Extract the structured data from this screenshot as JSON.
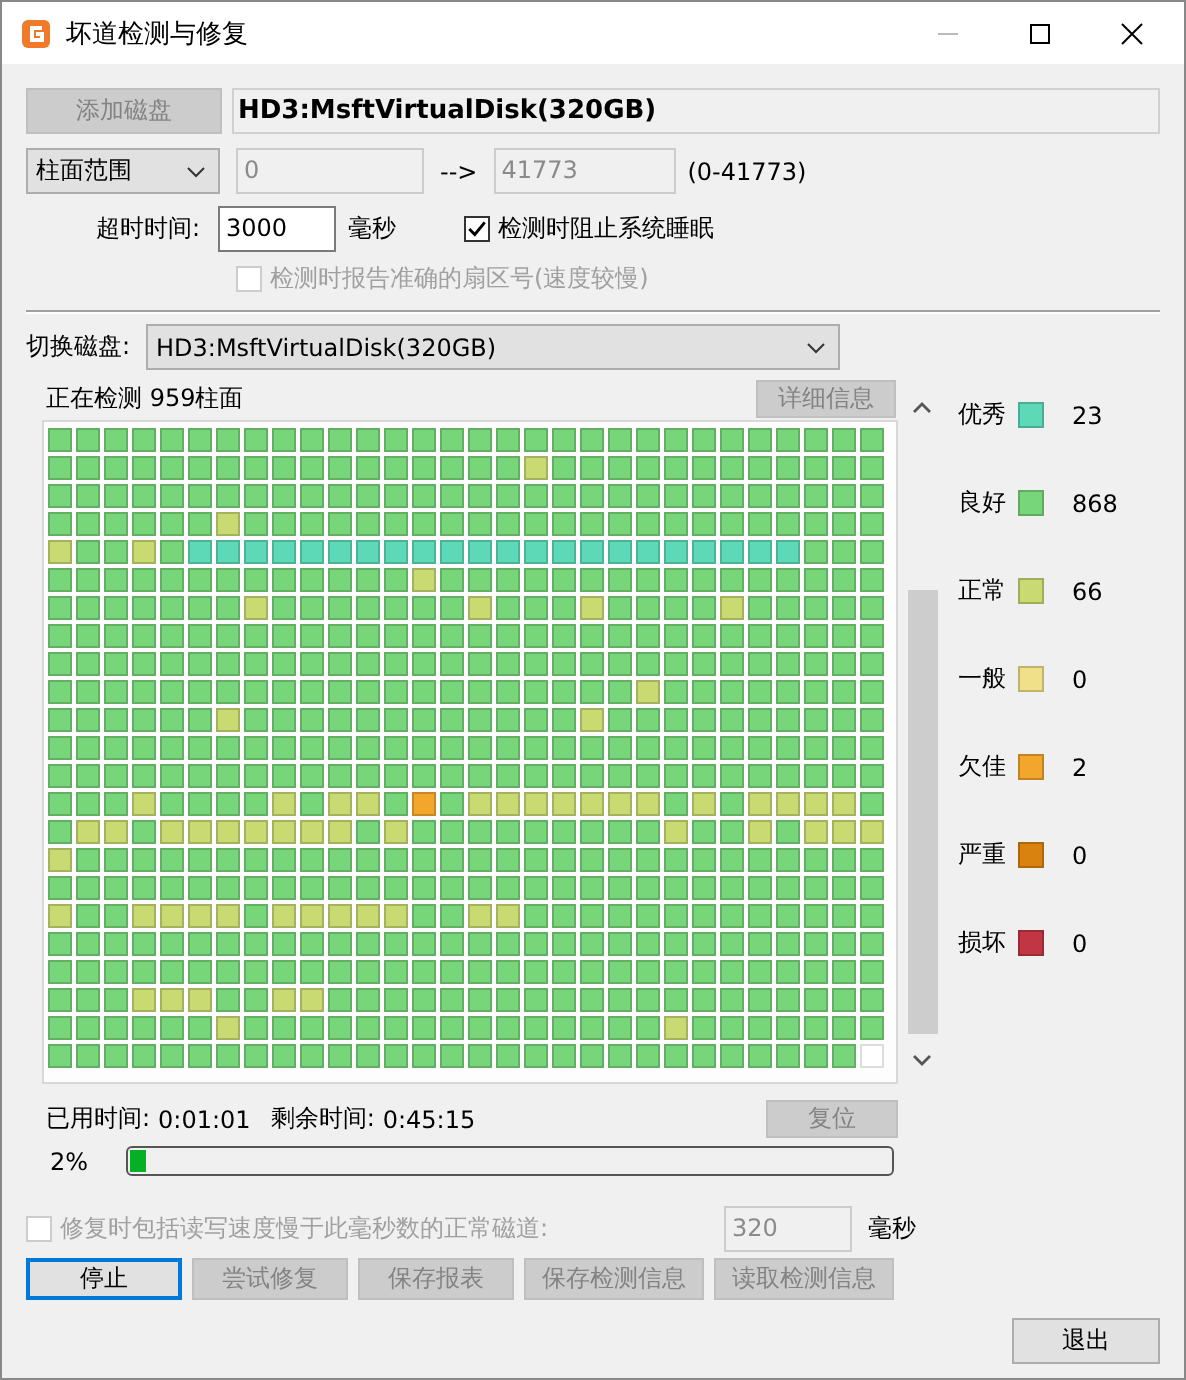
{
  "window": {
    "title": "坏道检测与修复"
  },
  "top": {
    "add_button": {
      "label": "添加磁盘",
      "disabled": true
    },
    "disk_name": "HD3:MsftVirtualDisk(320GB)",
    "range_select": "柱面范围",
    "range_from": "0",
    "arrow": "-->",
    "range_to": "41773",
    "range_hint": "(0-41773)",
    "timeout_label": "超时时间:",
    "timeout_value": "3000",
    "timeout_unit": "毫秒",
    "checkboxes": [
      {
        "label": "检测时阻止系统睡眠",
        "checked": true,
        "disabled": false
      },
      {
        "label": "检测时报告准确的扇区号(速度较慢)",
        "checked": false,
        "disabled": true
      }
    ]
  },
  "switch": {
    "label": "切换磁盘:",
    "value": "HD3:MsftVirtualDisk(320GB)"
  },
  "status": {
    "text": "正在检测 959柱面",
    "details_button": {
      "label": "详细信息",
      "disabled": true
    }
  },
  "grid": {
    "rows": [
      {
        "cells": [
          {
            "kind": "g"
          },
          {
            "kind": "g"
          },
          {
            "kind": "g"
          },
          {
            "kind": "g"
          },
          {
            "kind": "g"
          },
          {
            "kind": "g"
          },
          {
            "kind": "g"
          },
          {
            "kind": "g"
          },
          {
            "kind": "g"
          },
          {
            "kind": "g"
          },
          {
            "kind": "g"
          },
          {
            "kind": "g"
          },
          {
            "kind": "g"
          },
          {
            "kind": "g"
          },
          {
            "kind": "g"
          },
          {
            "kind": "g"
          },
          {
            "kind": "g"
          },
          {
            "kind": "g"
          },
          {
            "kind": "g"
          },
          {
            "kind": "g"
          },
          {
            "kind": "g"
          },
          {
            "kind": "g"
          },
          {
            "kind": "g"
          },
          {
            "kind": "g"
          },
          {
            "kind": "g"
          },
          {
            "kind": "g"
          },
          {
            "kind": "g"
          },
          {
            "kind": "g"
          },
          {
            "kind": "g"
          },
          {
            "kind": "g"
          }
        ]
      },
      {
        "cells": [
          {
            "kind": "g"
          },
          {
            "kind": "g"
          },
          {
            "kind": "g"
          },
          {
            "kind": "g"
          },
          {
            "kind": "g"
          },
          {
            "kind": "g"
          },
          {
            "kind": "g"
          },
          {
            "kind": "g"
          },
          {
            "kind": "g"
          },
          {
            "kind": "g"
          },
          {
            "kind": "g"
          },
          {
            "kind": "g"
          },
          {
            "kind": "g"
          },
          {
            "kind": "g"
          },
          {
            "kind": "g"
          },
          {
            "kind": "g"
          },
          {
            "kind": "g"
          },
          {
            "kind": "n"
          },
          {
            "kind": "g"
          },
          {
            "kind": "g"
          },
          {
            "kind": "g"
          },
          {
            "kind": "g"
          },
          {
            "kind": "g"
          },
          {
            "kind": "g"
          },
          {
            "kind": "g"
          },
          {
            "kind": "g"
          },
          {
            "kind": "g"
          },
          {
            "kind": "g"
          },
          {
            "kind": "g"
          },
          {
            "kind": "g"
          }
        ]
      },
      {
        "cells": [
          {
            "kind": "g"
          },
          {
            "kind": "g"
          },
          {
            "kind": "g"
          },
          {
            "kind": "g"
          },
          {
            "kind": "g"
          },
          {
            "kind": "g"
          },
          {
            "kind": "g"
          },
          {
            "kind": "g"
          },
          {
            "kind": "g"
          },
          {
            "kind": "g"
          },
          {
            "kind": "g"
          },
          {
            "kind": "g"
          },
          {
            "kind": "g"
          },
          {
            "kind": "g"
          },
          {
            "kind": "g"
          },
          {
            "kind": "g"
          },
          {
            "kind": "g"
          },
          {
            "kind": "g"
          },
          {
            "kind": "g"
          },
          {
            "kind": "g"
          },
          {
            "kind": "g"
          },
          {
            "kind": "g"
          },
          {
            "kind": "g"
          },
          {
            "kind": "g"
          },
          {
            "kind": "g"
          },
          {
            "kind": "g"
          },
          {
            "kind": "g"
          },
          {
            "kind": "g"
          },
          {
            "kind": "g"
          },
          {
            "kind": "g"
          }
        ]
      },
      {
        "cells": [
          {
            "kind": "g"
          },
          {
            "kind": "g"
          },
          {
            "kind": "g"
          },
          {
            "kind": "g"
          },
          {
            "kind": "g"
          },
          {
            "kind": "g"
          },
          {
            "kind": "n"
          },
          {
            "kind": "g"
          },
          {
            "kind": "g"
          },
          {
            "kind": "g"
          },
          {
            "kind": "g"
          },
          {
            "kind": "g"
          },
          {
            "kind": "g"
          },
          {
            "kind": "g"
          },
          {
            "kind": "g"
          },
          {
            "kind": "g"
          },
          {
            "kind": "g"
          },
          {
            "kind": "g"
          },
          {
            "kind": "g"
          },
          {
            "kind": "g"
          },
          {
            "kind": "g"
          },
          {
            "kind": "g"
          },
          {
            "kind": "g"
          },
          {
            "kind": "g"
          },
          {
            "kind": "g"
          },
          {
            "kind": "g"
          },
          {
            "kind": "g"
          },
          {
            "kind": "g"
          },
          {
            "kind": "g"
          },
          {
            "kind": "g"
          }
        ]
      },
      {
        "cells": [
          {
            "kind": "n"
          },
          {
            "kind": "g"
          },
          {
            "kind": "g"
          },
          {
            "kind": "n"
          },
          {
            "kind": "g"
          },
          {
            "kind": "c"
          },
          {
            "kind": "c"
          },
          {
            "kind": "c"
          },
          {
            "kind": "c"
          },
          {
            "kind": "c"
          },
          {
            "kind": "c"
          },
          {
            "kind": "c"
          },
          {
            "kind": "c"
          },
          {
            "kind": "c"
          },
          {
            "kind": "c"
          },
          {
            "kind": "c"
          },
          {
            "kind": "c"
          },
          {
            "kind": "c"
          },
          {
            "kind": "c"
          },
          {
            "kind": "c"
          },
          {
            "kind": "c"
          },
          {
            "kind": "c"
          },
          {
            "kind": "c"
          },
          {
            "kind": "c"
          },
          {
            "kind": "c"
          },
          {
            "kind": "c"
          },
          {
            "kind": "c"
          },
          {
            "kind": "g"
          },
          {
            "kind": "g"
          },
          {
            "kind": "g"
          }
        ]
      },
      {
        "cells": [
          {
            "kind": "g"
          },
          {
            "kind": "g"
          },
          {
            "kind": "g"
          },
          {
            "kind": "g"
          },
          {
            "kind": "g"
          },
          {
            "kind": "g"
          },
          {
            "kind": "g"
          },
          {
            "kind": "g"
          },
          {
            "kind": "g"
          },
          {
            "kind": "g"
          },
          {
            "kind": "g"
          },
          {
            "kind": "g"
          },
          {
            "kind": "g"
          },
          {
            "kind": "n"
          },
          {
            "kind": "g"
          },
          {
            "kind": "g"
          },
          {
            "kind": "g"
          },
          {
            "kind": "g"
          },
          {
            "kind": "g"
          },
          {
            "kind": "g"
          },
          {
            "kind": "g"
          },
          {
            "kind": "g"
          },
          {
            "kind": "g"
          },
          {
            "kind": "g"
          },
          {
            "kind": "g"
          },
          {
            "kind": "g"
          },
          {
            "kind": "g"
          },
          {
            "kind": "g"
          },
          {
            "kind": "g"
          },
          {
            "kind": "g"
          }
        ]
      },
      {
        "cells": [
          {
            "kind": "g"
          },
          {
            "kind": "g"
          },
          {
            "kind": "g"
          },
          {
            "kind": "g"
          },
          {
            "kind": "g"
          },
          {
            "kind": "g"
          },
          {
            "kind": "g"
          },
          {
            "kind": "n"
          },
          {
            "kind": "g"
          },
          {
            "kind": "g"
          },
          {
            "kind": "g"
          },
          {
            "kind": "g"
          },
          {
            "kind": "g"
          },
          {
            "kind": "g"
          },
          {
            "kind": "g"
          },
          {
            "kind": "n"
          },
          {
            "kind": "g"
          },
          {
            "kind": "g"
          },
          {
            "kind": "g"
          },
          {
            "kind": "n"
          },
          {
            "kind": "g"
          },
          {
            "kind": "g"
          },
          {
            "kind": "g"
          },
          {
            "kind": "g"
          },
          {
            "kind": "n"
          },
          {
            "kind": "g"
          },
          {
            "kind": "g"
          },
          {
            "kind": "g"
          },
          {
            "kind": "g"
          },
          {
            "kind": "g"
          }
        ]
      },
      {
        "cells": [
          {
            "kind": "g"
          },
          {
            "kind": "g"
          },
          {
            "kind": "g"
          },
          {
            "kind": "g"
          },
          {
            "kind": "g"
          },
          {
            "kind": "g"
          },
          {
            "kind": "g"
          },
          {
            "kind": "g"
          },
          {
            "kind": "g"
          },
          {
            "kind": "g"
          },
          {
            "kind": "g"
          },
          {
            "kind": "g"
          },
          {
            "kind": "g"
          },
          {
            "kind": "g"
          },
          {
            "kind": "g"
          },
          {
            "kind": "g"
          },
          {
            "kind": "g"
          },
          {
            "kind": "g"
          },
          {
            "kind": "g"
          },
          {
            "kind": "g"
          },
          {
            "kind": "g"
          },
          {
            "kind": "g"
          },
          {
            "kind": "g"
          },
          {
            "kind": "g"
          },
          {
            "kind": "g"
          },
          {
            "kind": "g"
          },
          {
            "kind": "g"
          },
          {
            "kind": "g"
          },
          {
            "kind": "g"
          },
          {
            "kind": "g"
          }
        ]
      },
      {
        "cells": [
          {
            "kind": "g"
          },
          {
            "kind": "g"
          },
          {
            "kind": "g"
          },
          {
            "kind": "g"
          },
          {
            "kind": "g"
          },
          {
            "kind": "g"
          },
          {
            "kind": "g"
          },
          {
            "kind": "g"
          },
          {
            "kind": "g"
          },
          {
            "kind": "g"
          },
          {
            "kind": "g"
          },
          {
            "kind": "g"
          },
          {
            "kind": "g"
          },
          {
            "kind": "g"
          },
          {
            "kind": "g"
          },
          {
            "kind": "g"
          },
          {
            "kind": "g"
          },
          {
            "kind": "g"
          },
          {
            "kind": "g"
          },
          {
            "kind": "g"
          },
          {
            "kind": "g"
          },
          {
            "kind": "g"
          },
          {
            "kind": "g"
          },
          {
            "kind": "g"
          },
          {
            "kind": "g"
          },
          {
            "kind": "g"
          },
          {
            "kind": "g"
          },
          {
            "kind": "g"
          },
          {
            "kind": "g"
          },
          {
            "kind": "g"
          }
        ]
      },
      {
        "cells": [
          {
            "kind": "g"
          },
          {
            "kind": "g"
          },
          {
            "kind": "g"
          },
          {
            "kind": "g"
          },
          {
            "kind": "g"
          },
          {
            "kind": "g"
          },
          {
            "kind": "g"
          },
          {
            "kind": "g"
          },
          {
            "kind": "g"
          },
          {
            "kind": "g"
          },
          {
            "kind": "g"
          },
          {
            "kind": "g"
          },
          {
            "kind": "g"
          },
          {
            "kind": "g"
          },
          {
            "kind": "g"
          },
          {
            "kind": "g"
          },
          {
            "kind": "g"
          },
          {
            "kind": "g"
          },
          {
            "kind": "g"
          },
          {
            "kind": "g"
          },
          {
            "kind": "g"
          },
          {
            "kind": "n"
          },
          {
            "kind": "g"
          },
          {
            "kind": "g"
          },
          {
            "kind": "g"
          },
          {
            "kind": "g"
          },
          {
            "kind": "g"
          },
          {
            "kind": "g"
          },
          {
            "kind": "g"
          },
          {
            "kind": "g"
          }
        ]
      },
      {
        "cells": [
          {
            "kind": "g"
          },
          {
            "kind": "g"
          },
          {
            "kind": "g"
          },
          {
            "kind": "g"
          },
          {
            "kind": "g"
          },
          {
            "kind": "g"
          },
          {
            "kind": "n"
          },
          {
            "kind": "g"
          },
          {
            "kind": "g"
          },
          {
            "kind": "g"
          },
          {
            "kind": "g"
          },
          {
            "kind": "g"
          },
          {
            "kind": "g"
          },
          {
            "kind": "g"
          },
          {
            "kind": "g"
          },
          {
            "kind": "g"
          },
          {
            "kind": "g"
          },
          {
            "kind": "g"
          },
          {
            "kind": "g"
          },
          {
            "kind": "n"
          },
          {
            "kind": "g"
          },
          {
            "kind": "g"
          },
          {
            "kind": "g"
          },
          {
            "kind": "g"
          },
          {
            "kind": "g"
          },
          {
            "kind": "g"
          },
          {
            "kind": "g"
          },
          {
            "kind": "g"
          },
          {
            "kind": "g"
          },
          {
            "kind": "g"
          }
        ]
      },
      {
        "cells": [
          {
            "kind": "g"
          },
          {
            "kind": "g"
          },
          {
            "kind": "g"
          },
          {
            "kind": "g"
          },
          {
            "kind": "g"
          },
          {
            "kind": "g"
          },
          {
            "kind": "g"
          },
          {
            "kind": "g"
          },
          {
            "kind": "g"
          },
          {
            "kind": "g"
          },
          {
            "kind": "g"
          },
          {
            "kind": "g"
          },
          {
            "kind": "g"
          },
          {
            "kind": "g"
          },
          {
            "kind": "g"
          },
          {
            "kind": "g"
          },
          {
            "kind": "g"
          },
          {
            "kind": "g"
          },
          {
            "kind": "g"
          },
          {
            "kind": "g"
          },
          {
            "kind": "g"
          },
          {
            "kind": "g"
          },
          {
            "kind": "g"
          },
          {
            "kind": "g"
          },
          {
            "kind": "g"
          },
          {
            "kind": "g"
          },
          {
            "kind": "g"
          },
          {
            "kind": "g"
          },
          {
            "kind": "g"
          },
          {
            "kind": "g"
          }
        ]
      },
      {
        "cells": [
          {
            "kind": "g"
          },
          {
            "kind": "g"
          },
          {
            "kind": "g"
          },
          {
            "kind": "g"
          },
          {
            "kind": "g"
          },
          {
            "kind": "g"
          },
          {
            "kind": "g"
          },
          {
            "kind": "g"
          },
          {
            "kind": "g"
          },
          {
            "kind": "g"
          },
          {
            "kind": "g"
          },
          {
            "kind": "g"
          },
          {
            "kind": "g"
          },
          {
            "kind": "g"
          },
          {
            "kind": "g"
          },
          {
            "kind": "g"
          },
          {
            "kind": "g"
          },
          {
            "kind": "g"
          },
          {
            "kind": "g"
          },
          {
            "kind": "g"
          },
          {
            "kind": "g"
          },
          {
            "kind": "g"
          },
          {
            "kind": "g"
          },
          {
            "kind": "g"
          },
          {
            "kind": "g"
          },
          {
            "kind": "g"
          },
          {
            "kind": "g"
          },
          {
            "kind": "g"
          },
          {
            "kind": "g"
          },
          {
            "kind": "g"
          }
        ]
      },
      {
        "cells": [
          {
            "kind": "g"
          },
          {
            "kind": "g"
          },
          {
            "kind": "g"
          },
          {
            "kind": "n"
          },
          {
            "kind": "g"
          },
          {
            "kind": "g"
          },
          {
            "kind": "g"
          },
          {
            "kind": "g"
          },
          {
            "kind": "n"
          },
          {
            "kind": "g"
          },
          {
            "kind": "n"
          },
          {
            "kind": "n"
          },
          {
            "kind": "g"
          },
          {
            "kind": "f"
          },
          {
            "kind": "g"
          },
          {
            "kind": "n"
          },
          {
            "kind": "n"
          },
          {
            "kind": "n"
          },
          {
            "kind": "n"
          },
          {
            "kind": "n"
          },
          {
            "kind": "n"
          },
          {
            "kind": "n"
          },
          {
            "kind": "g"
          },
          {
            "kind": "n"
          },
          {
            "kind": "g"
          },
          {
            "kind": "n"
          },
          {
            "kind": "n"
          },
          {
            "kind": "n"
          },
          {
            "kind": "n"
          },
          {
            "kind": "g"
          }
        ]
      },
      {
        "cells": [
          {
            "kind": "g"
          },
          {
            "kind": "n"
          },
          {
            "kind": "n"
          },
          {
            "kind": "g"
          },
          {
            "kind": "n"
          },
          {
            "kind": "n"
          },
          {
            "kind": "n"
          },
          {
            "kind": "n"
          },
          {
            "kind": "n"
          },
          {
            "kind": "n"
          },
          {
            "kind": "n"
          },
          {
            "kind": "g"
          },
          {
            "kind": "n"
          },
          {
            "kind": "g"
          },
          {
            "kind": "g"
          },
          {
            "kind": "g"
          },
          {
            "kind": "g"
          },
          {
            "kind": "g"
          },
          {
            "kind": "g"
          },
          {
            "kind": "g"
          },
          {
            "kind": "g"
          },
          {
            "kind": "g"
          },
          {
            "kind": "n"
          },
          {
            "kind": "g"
          },
          {
            "kind": "g"
          },
          {
            "kind": "n"
          },
          {
            "kind": "g"
          },
          {
            "kind": "n"
          },
          {
            "kind": "n"
          },
          {
            "kind": "n"
          }
        ]
      },
      {
        "cells": [
          {
            "kind": "n"
          },
          {
            "kind": "g"
          },
          {
            "kind": "g"
          },
          {
            "kind": "g"
          },
          {
            "kind": "g"
          },
          {
            "kind": "g"
          },
          {
            "kind": "g"
          },
          {
            "kind": "g"
          },
          {
            "kind": "g"
          },
          {
            "kind": "g"
          },
          {
            "kind": "g"
          },
          {
            "kind": "g"
          },
          {
            "kind": "g"
          },
          {
            "kind": "g"
          },
          {
            "kind": "g"
          },
          {
            "kind": "g"
          },
          {
            "kind": "g"
          },
          {
            "kind": "g"
          },
          {
            "kind": "g"
          },
          {
            "kind": "g"
          },
          {
            "kind": "g"
          },
          {
            "kind": "g"
          },
          {
            "kind": "g"
          },
          {
            "kind": "g"
          },
          {
            "kind": "g"
          },
          {
            "kind": "g"
          },
          {
            "kind": "g"
          },
          {
            "kind": "g"
          },
          {
            "kind": "g"
          },
          {
            "kind": "g"
          }
        ]
      },
      {
        "cells": [
          {
            "kind": "g"
          },
          {
            "kind": "g"
          },
          {
            "kind": "g"
          },
          {
            "kind": "g"
          },
          {
            "kind": "g"
          },
          {
            "kind": "g"
          },
          {
            "kind": "g"
          },
          {
            "kind": "g"
          },
          {
            "kind": "g"
          },
          {
            "kind": "g"
          },
          {
            "kind": "g"
          },
          {
            "kind": "g"
          },
          {
            "kind": "g"
          },
          {
            "kind": "g"
          },
          {
            "kind": "g"
          },
          {
            "kind": "g"
          },
          {
            "kind": "g"
          },
          {
            "kind": "g"
          },
          {
            "kind": "g"
          },
          {
            "kind": "g"
          },
          {
            "kind": "g"
          },
          {
            "kind": "g"
          },
          {
            "kind": "g"
          },
          {
            "kind": "g"
          },
          {
            "kind": "g"
          },
          {
            "kind": "g"
          },
          {
            "kind": "g"
          },
          {
            "kind": "g"
          },
          {
            "kind": "g"
          },
          {
            "kind": "g"
          }
        ]
      },
      {
        "cells": [
          {
            "kind": "n"
          },
          {
            "kind": "g"
          },
          {
            "kind": "g"
          },
          {
            "kind": "n"
          },
          {
            "kind": "n"
          },
          {
            "kind": "n"
          },
          {
            "kind": "n"
          },
          {
            "kind": "g"
          },
          {
            "kind": "n"
          },
          {
            "kind": "n"
          },
          {
            "kind": "n"
          },
          {
            "kind": "n"
          },
          {
            "kind": "n"
          },
          {
            "kind": "g"
          },
          {
            "kind": "g"
          },
          {
            "kind": "n"
          },
          {
            "kind": "n"
          },
          {
            "kind": "g"
          },
          {
            "kind": "g"
          },
          {
            "kind": "g"
          },
          {
            "kind": "g"
          },
          {
            "kind": "g"
          },
          {
            "kind": "g"
          },
          {
            "kind": "g"
          },
          {
            "kind": "g"
          },
          {
            "kind": "g"
          },
          {
            "kind": "g"
          },
          {
            "kind": "g"
          },
          {
            "kind": "g"
          },
          {
            "kind": "g"
          }
        ]
      },
      {
        "cells": [
          {
            "kind": "g"
          },
          {
            "kind": "g"
          },
          {
            "kind": "g"
          },
          {
            "kind": "g"
          },
          {
            "kind": "g"
          },
          {
            "kind": "g"
          },
          {
            "kind": "g"
          },
          {
            "kind": "g"
          },
          {
            "kind": "g"
          },
          {
            "kind": "g"
          },
          {
            "kind": "g"
          },
          {
            "kind": "g"
          },
          {
            "kind": "g"
          },
          {
            "kind": "g"
          },
          {
            "kind": "g"
          },
          {
            "kind": "g"
          },
          {
            "kind": "g"
          },
          {
            "kind": "g"
          },
          {
            "kind": "g"
          },
          {
            "kind": "g"
          },
          {
            "kind": "g"
          },
          {
            "kind": "g"
          },
          {
            "kind": "g"
          },
          {
            "kind": "g"
          },
          {
            "kind": "g"
          },
          {
            "kind": "g"
          },
          {
            "kind": "g"
          },
          {
            "kind": "g"
          },
          {
            "kind": "g"
          },
          {
            "kind": "g"
          }
        ]
      },
      {
        "cells": [
          {
            "kind": "g"
          },
          {
            "kind": "g"
          },
          {
            "kind": "g"
          },
          {
            "kind": "g"
          },
          {
            "kind": "g"
          },
          {
            "kind": "g"
          },
          {
            "kind": "g"
          },
          {
            "kind": "g"
          },
          {
            "kind": "g"
          },
          {
            "kind": "g"
          },
          {
            "kind": "g"
          },
          {
            "kind": "g"
          },
          {
            "kind": "g"
          },
          {
            "kind": "g"
          },
          {
            "kind": "g"
          },
          {
            "kind": "g"
          },
          {
            "kind": "g"
          },
          {
            "kind": "g"
          },
          {
            "kind": "g"
          },
          {
            "kind": "g"
          },
          {
            "kind": "g"
          },
          {
            "kind": "g"
          },
          {
            "kind": "g"
          },
          {
            "kind": "g"
          },
          {
            "kind": "g"
          },
          {
            "kind": "g"
          },
          {
            "kind": "g"
          },
          {
            "kind": "g"
          },
          {
            "kind": "g"
          },
          {
            "kind": "g"
          }
        ]
      },
      {
        "cells": [
          {
            "kind": "g"
          },
          {
            "kind": "g"
          },
          {
            "kind": "g"
          },
          {
            "kind": "n"
          },
          {
            "kind": "n"
          },
          {
            "kind": "n"
          },
          {
            "kind": "g"
          },
          {
            "kind": "g"
          },
          {
            "kind": "n"
          },
          {
            "kind": "n"
          },
          {
            "kind": "g"
          },
          {
            "kind": "g"
          },
          {
            "kind": "g"
          },
          {
            "kind": "g"
          },
          {
            "kind": "g"
          },
          {
            "kind": "g"
          },
          {
            "kind": "g"
          },
          {
            "kind": "g"
          },
          {
            "kind": "g"
          },
          {
            "kind": "g"
          },
          {
            "kind": "g"
          },
          {
            "kind": "g"
          },
          {
            "kind": "g"
          },
          {
            "kind": "g"
          },
          {
            "kind": "g"
          },
          {
            "kind": "g"
          },
          {
            "kind": "g"
          },
          {
            "kind": "g"
          },
          {
            "kind": "g"
          },
          {
            "kind": "g"
          }
        ]
      },
      {
        "cells": [
          {
            "kind": "g"
          },
          {
            "kind": "g"
          },
          {
            "kind": "g"
          },
          {
            "kind": "g"
          },
          {
            "kind": "g"
          },
          {
            "kind": "g"
          },
          {
            "kind": "n"
          },
          {
            "kind": "g"
          },
          {
            "kind": "g"
          },
          {
            "kind": "g"
          },
          {
            "kind": "g"
          },
          {
            "kind": "g"
          },
          {
            "kind": "g"
          },
          {
            "kind": "g"
          },
          {
            "kind": "g"
          },
          {
            "kind": "g"
          },
          {
            "kind": "g"
          },
          {
            "kind": "g"
          },
          {
            "kind": "g"
          },
          {
            "kind": "g"
          },
          {
            "kind": "g"
          },
          {
            "kind": "g"
          },
          {
            "kind": "n"
          },
          {
            "kind": "g"
          },
          {
            "kind": "g"
          },
          {
            "kind": "g"
          },
          {
            "kind": "g"
          },
          {
            "kind": "g"
          },
          {
            "kind": "g"
          },
          {
            "kind": "g"
          }
        ]
      },
      {
        "cells": [
          {
            "kind": "g"
          },
          {
            "kind": "g"
          },
          {
            "kind": "g"
          },
          {
            "kind": "g"
          },
          {
            "kind": "g"
          },
          {
            "kind": "g"
          },
          {
            "kind": "g"
          },
          {
            "kind": "g"
          },
          {
            "kind": "g"
          },
          {
            "kind": "g"
          },
          {
            "kind": "g"
          },
          {
            "kind": "g"
          },
          {
            "kind": "g"
          },
          {
            "kind": "g"
          },
          {
            "kind": "g"
          },
          {
            "kind": "g"
          },
          {
            "kind": "g"
          },
          {
            "kind": "g"
          },
          {
            "kind": "g"
          },
          {
            "kind": "g"
          },
          {
            "kind": "g"
          },
          {
            "kind": "g"
          },
          {
            "kind": "g"
          },
          {
            "kind": "g"
          },
          {
            "kind": "g"
          },
          {
            "kind": "g"
          },
          {
            "kind": "g"
          },
          {
            "kind": "g"
          },
          {
            "kind": "g"
          },
          {
            "kind": "e"
          }
        ]
      }
    ]
  },
  "legend": [
    {
      "kind": "c",
      "label": "优秀",
      "color": "#5ed9b8",
      "count": "23"
    },
    {
      "kind": "g",
      "label": "良好",
      "color": "#78d67a",
      "count": "868"
    },
    {
      "kind": "n",
      "label": "正常",
      "color": "#c9da72",
      "count": "66"
    },
    {
      "kind": "y",
      "label": "一般",
      "color": "#f1e08a",
      "count": "0"
    },
    {
      "kind": "f",
      "label": "欠佳",
      "color": "#f2a62c",
      "count": "2"
    },
    {
      "kind": "s",
      "label": "严重",
      "color": "#d9820f",
      "count": "0"
    },
    {
      "kind": "b",
      "label": "损坏",
      "color": "#c23543",
      "count": "0"
    }
  ],
  "timing": {
    "elapsed_label": "已用时间:",
    "elapsed": "0:01:01",
    "remaining_label": "剩余时间:",
    "remaining": "0:45:15",
    "reset_button": {
      "label": "复位",
      "disabled": true
    }
  },
  "progress": {
    "reading": "2%",
    "level": 0.02
  },
  "repair_option": {
    "label": "修复时包括读写速度慢于此毫秒数的正常磁道:",
    "checked": false,
    "disabled": true,
    "value": "320",
    "unit": "毫秒"
  },
  "buttons": [
    {
      "label": "停止",
      "disabled": false,
      "focused": true
    },
    {
      "label": "尝试修复",
      "disabled": true,
      "focused": false
    },
    {
      "label": "保存报表",
      "disabled": true,
      "focused": false
    },
    {
      "label": "保存检测信息",
      "disabled": true,
      "focused": false
    },
    {
      "label": "读取检测信息",
      "disabled": true,
      "focused": false
    }
  ],
  "exit_button": {
    "label": "退出",
    "disabled": false
  }
}
